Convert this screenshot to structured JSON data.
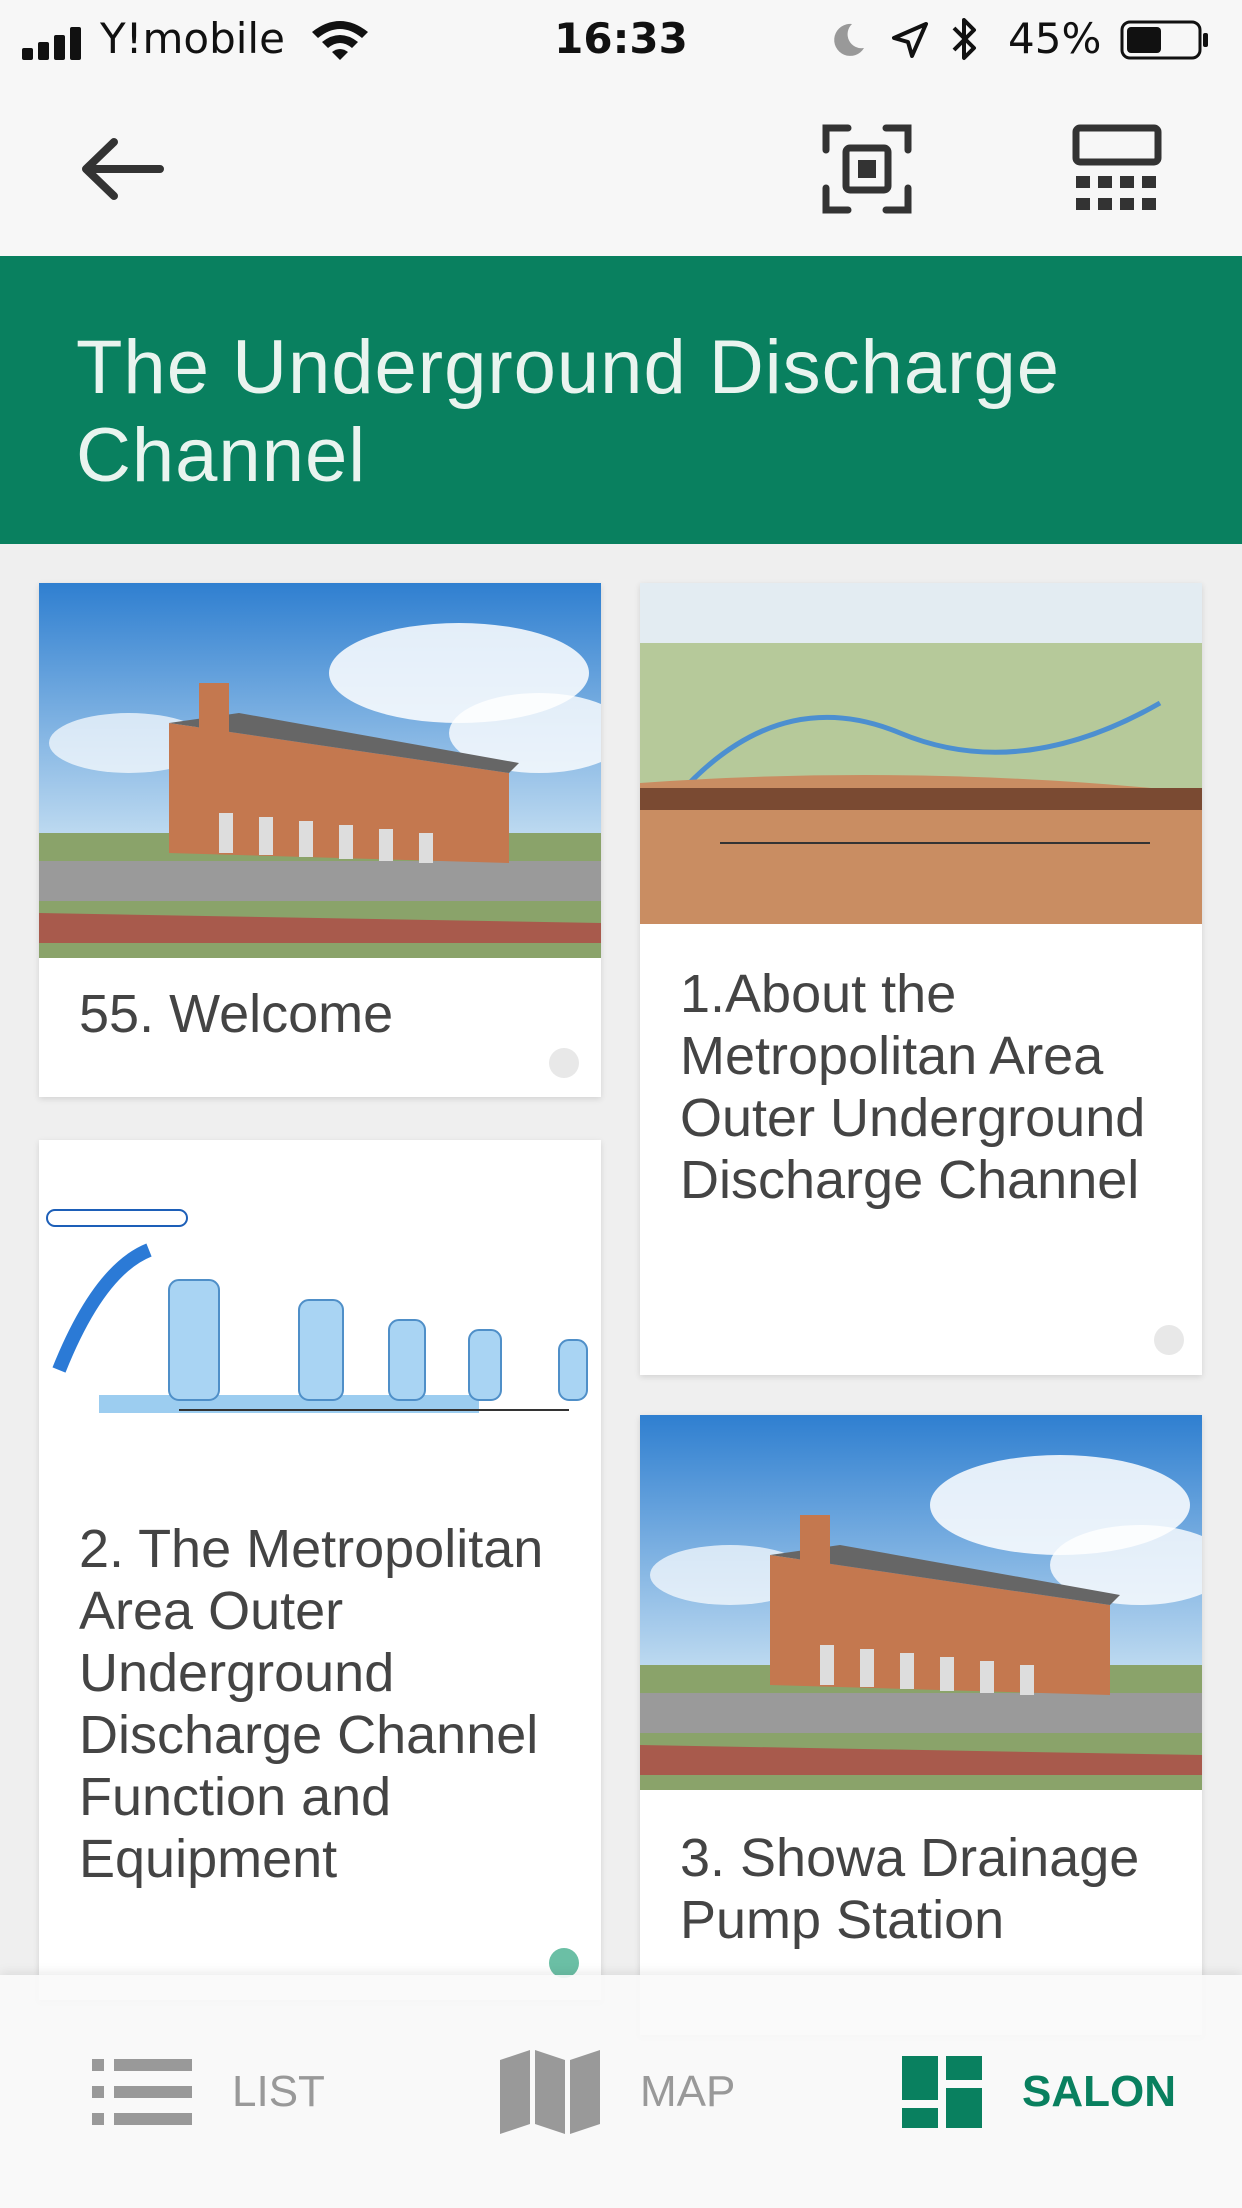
{
  "status_bar": {
    "carrier": "Y!mobile",
    "time": "16:33",
    "battery": "45%"
  },
  "nav": {
    "icons": [
      "back-arrow-icon",
      "scan-icon",
      "calculator-icon"
    ]
  },
  "header": {
    "title": "The Underground Discharge Channel"
  },
  "cards": [
    {
      "label": "55. Welcome",
      "image": "building-photo"
    },
    {
      "label": "1.About the Metropolitan Area Outer Underground Discharge Channel",
      "image": "overview-diagram"
    },
    {
      "label": "2. The Metropolitan Area Outer Underground Discharge Channel Function and Equipment",
      "image": "configuration-diagram"
    },
    {
      "label": "3. Showa Drainage Pump Station",
      "image": "building-photo"
    }
  ],
  "tabs": [
    {
      "label": "LIST",
      "icon": "list-icon",
      "active": false
    },
    {
      "label": "MAP",
      "icon": "map-icon",
      "active": false
    },
    {
      "label": "SALON",
      "icon": "grid-icon",
      "active": true
    }
  ],
  "colors": {
    "accent": "#09805f",
    "background": "#efefef"
  }
}
